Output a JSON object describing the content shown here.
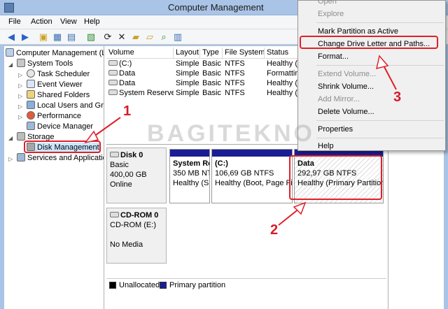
{
  "window": {
    "title": "Computer Management"
  },
  "menu": [
    "File",
    "Action",
    "View",
    "Help"
  ],
  "tree": {
    "root": "Computer Management (L",
    "system_tools": "System Tools",
    "task_scheduler": "Task Scheduler",
    "event_viewer": "Event Viewer",
    "shared_folders": "Shared Folders",
    "local_users": "Local Users and Gro",
    "performance": "Performance",
    "device_manager": "Device Manager",
    "storage": "Storage",
    "disk_management": "Disk Management",
    "services": "Services and Applicatio"
  },
  "volume_table": {
    "headers": [
      "Volume",
      "Layout",
      "Type",
      "File System",
      "Status"
    ],
    "rows": [
      [
        "(C:)",
        "Simple",
        "Basic",
        "NTFS",
        "Healthy (E"
      ],
      [
        "Data",
        "Simple",
        "Basic",
        "NTFS",
        "Formattin"
      ],
      [
        "Data",
        "Simple",
        "Basic",
        "NTFS",
        "Healthy (P"
      ],
      [
        "System Reserved",
        "Simple",
        "Basic",
        "NTFS",
        "Healthy (S"
      ]
    ]
  },
  "disk0": {
    "name": "Disk 0",
    "type": "Basic",
    "size": "400,00 GB",
    "state": "Online",
    "partitions": [
      {
        "name": "System Re",
        "size": "350 MB NT",
        "status": "Healthy (S"
      },
      {
        "name": "(C:)",
        "size": "106,69 GB NTFS",
        "status": "Healthy (Boot, Page File"
      },
      {
        "name": "Data",
        "size": "292,97 GB NTFS",
        "status": "Healthy (Primary Partition)"
      }
    ]
  },
  "cdrom": {
    "name": "CD-ROM 0",
    "drive": "CD-ROM (E:)",
    "media": "No Media"
  },
  "legend": {
    "unallocated": "Unallocated",
    "primary": "Primary partition"
  },
  "context_menu": {
    "open": "Open",
    "explore": "Explore",
    "mark_active": "Mark Partition as Active",
    "change_letter": "Change Drive Letter and Paths...",
    "format": "Format...",
    "extend": "Extend Volume...",
    "shrink": "Shrink Volume...",
    "add_mirror": "Add Mirror...",
    "delete": "Delete Volume...",
    "properties": "Properties",
    "help": "Help"
  },
  "annotations": {
    "n1": "1",
    "n2": "2",
    "n3": "3"
  },
  "watermark": "BAGITEKNO",
  "colors": {
    "primary_partition": "#1a1e94",
    "highlight": "#e0202a"
  }
}
